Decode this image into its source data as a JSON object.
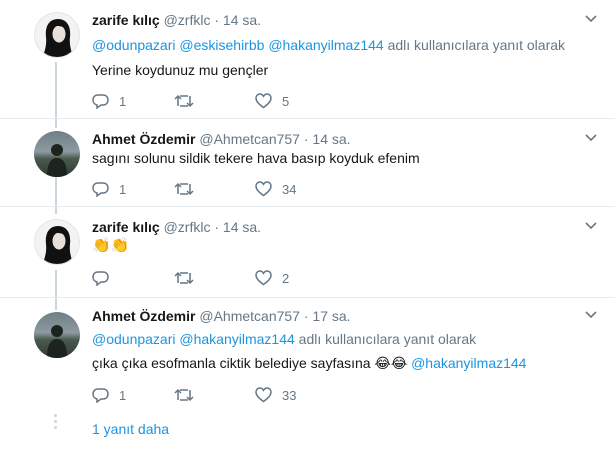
{
  "replying_to_suffix": "adlı kullanıcılara yanıt olarak",
  "tweets": [
    {
      "name": "zarife kılıç",
      "handle": "@zrfklc",
      "dot": "·",
      "time": "14 sa.",
      "mentions": [
        "@odunpazari",
        "@eskisehirbb",
        "@hakanyilmaz144"
      ],
      "text": "Yerine koydunuz mu gençler",
      "replies": "1",
      "retweets": "",
      "likes": "5"
    },
    {
      "name": "Ahmet Özdemir",
      "handle": "@Ahmetcan757",
      "dot": "·",
      "time": "14 sa.",
      "text": "sagını solunu sildik tekere hava basıp koyduk efenim",
      "replies": "1",
      "retweets": "",
      "likes": "34"
    },
    {
      "name": "zarife kılıç",
      "handle": "@zrfklc",
      "dot": "·",
      "time": "14 sa.",
      "text": "👏👏",
      "replies": "",
      "retweets": "",
      "likes": "2"
    },
    {
      "name": "Ahmet Özdemir",
      "handle": "@Ahmetcan757",
      "dot": "·",
      "time": "17 sa.",
      "mentions": [
        "@odunpazari",
        "@hakanyilmaz144"
      ],
      "text": "çıka çıka esofmanla ciktik belediye sayfasına",
      "emoji": "😂😂",
      "text_mention": "@hakanyilmaz144",
      "replies": "1",
      "retweets": "",
      "likes": "33"
    }
  ],
  "more_replies": "1 yanıt daha",
  "colors": {
    "link": "#1b95e0",
    "muted": "#657786",
    "line": "#ccd6dd"
  }
}
